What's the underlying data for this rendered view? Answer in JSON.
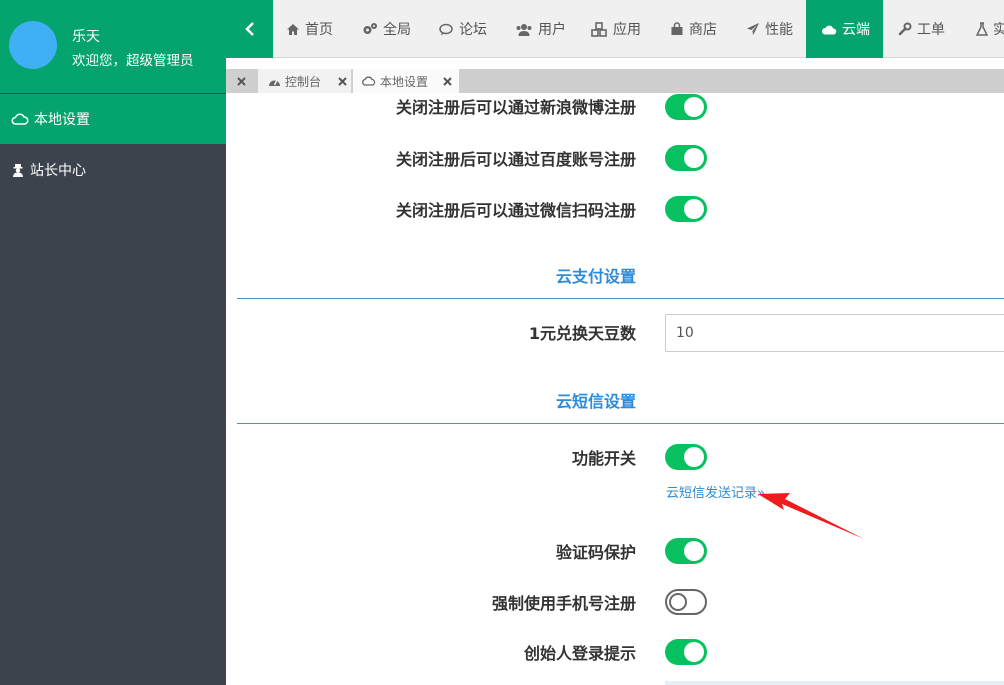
{
  "user": {
    "name": "乐天",
    "welcome": "欢迎您，超级管理员"
  },
  "sidebar": {
    "items": [
      {
        "label": "本地设置",
        "icon": "cloud-icon",
        "active": true
      },
      {
        "label": "站长中心",
        "icon": "user-secret-icon",
        "active": false
      }
    ]
  },
  "topnav": {
    "items": [
      {
        "label": "首页",
        "icon": "home-icon"
      },
      {
        "label": "全局",
        "icon": "gears-icon"
      },
      {
        "label": "论坛",
        "icon": "comments-icon"
      },
      {
        "label": "用户",
        "icon": "users-icon"
      },
      {
        "label": "应用",
        "icon": "cubes-icon"
      },
      {
        "label": "商店",
        "icon": "shopping-bag-icon"
      },
      {
        "label": "性能",
        "icon": "paper-plane-icon"
      },
      {
        "label": "云端",
        "icon": "cloud-icon",
        "active": true
      },
      {
        "label": "工单",
        "icon": "wrench-icon"
      },
      {
        "label": "实",
        "icon": "flask-icon"
      }
    ]
  },
  "tabs": [
    {
      "label": "控制台",
      "icon": "dashboard-icon"
    },
    {
      "label": "本地设置",
      "icon": "cloud-icon"
    }
  ],
  "settings": {
    "weibo_register": {
      "label": "关闭注册后可以通过新浪微博注册",
      "enabled": true
    },
    "baidu_register": {
      "label": "关闭注册后可以通过百度账号注册",
      "enabled": true
    },
    "wechat_register": {
      "label": "关闭注册后可以通过微信扫码注册",
      "enabled": true
    },
    "pay_section": "云支付设置",
    "exchange": {
      "label": "1元兑换天豆数",
      "value": "10"
    },
    "sms_section": "云短信设置",
    "sms_switch": {
      "label": "功能开关",
      "enabled": true
    },
    "sms_record_link": "云短信发送记录»",
    "captcha": {
      "label": "验证码保护",
      "enabled": true
    },
    "force_phone": {
      "label": "强制使用手机号注册",
      "enabled": false
    },
    "founder_login": {
      "label": "创始人登录提示",
      "enabled": true
    }
  },
  "colors": {
    "accent": "#05a36d",
    "sidebar": "#3c434c",
    "toggle_on": "#07c160",
    "link": "#2e8bd8",
    "annotation": "#ee1c1c"
  }
}
